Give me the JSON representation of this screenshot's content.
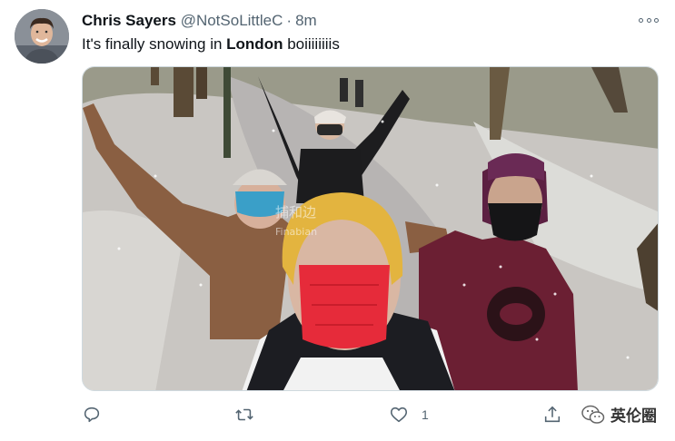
{
  "tweet": {
    "author_name": "Chris Sayers",
    "author_handle": "@NotSoLittleC",
    "separator": "·",
    "time": "8m",
    "text_before": "It's finally snowing in ",
    "text_bold": "London",
    "text_after": " boiiiiiiiis"
  },
  "media": {
    "overlay_watermark_top": "捕和边",
    "overlay_watermark_bottom": "Finabian"
  },
  "actions": {
    "reply_icon": "reply-icon",
    "retweet_icon": "retweet-icon",
    "like_icon": "heart-icon",
    "like_count": "1",
    "share_icon": "share-icon"
  },
  "watermark": {
    "label": "英伦圈",
    "icon": "wechat-icon"
  },
  "colors": {
    "text_primary": "#0f1419",
    "text_secondary": "#536471",
    "border": "#cfd9de"
  }
}
